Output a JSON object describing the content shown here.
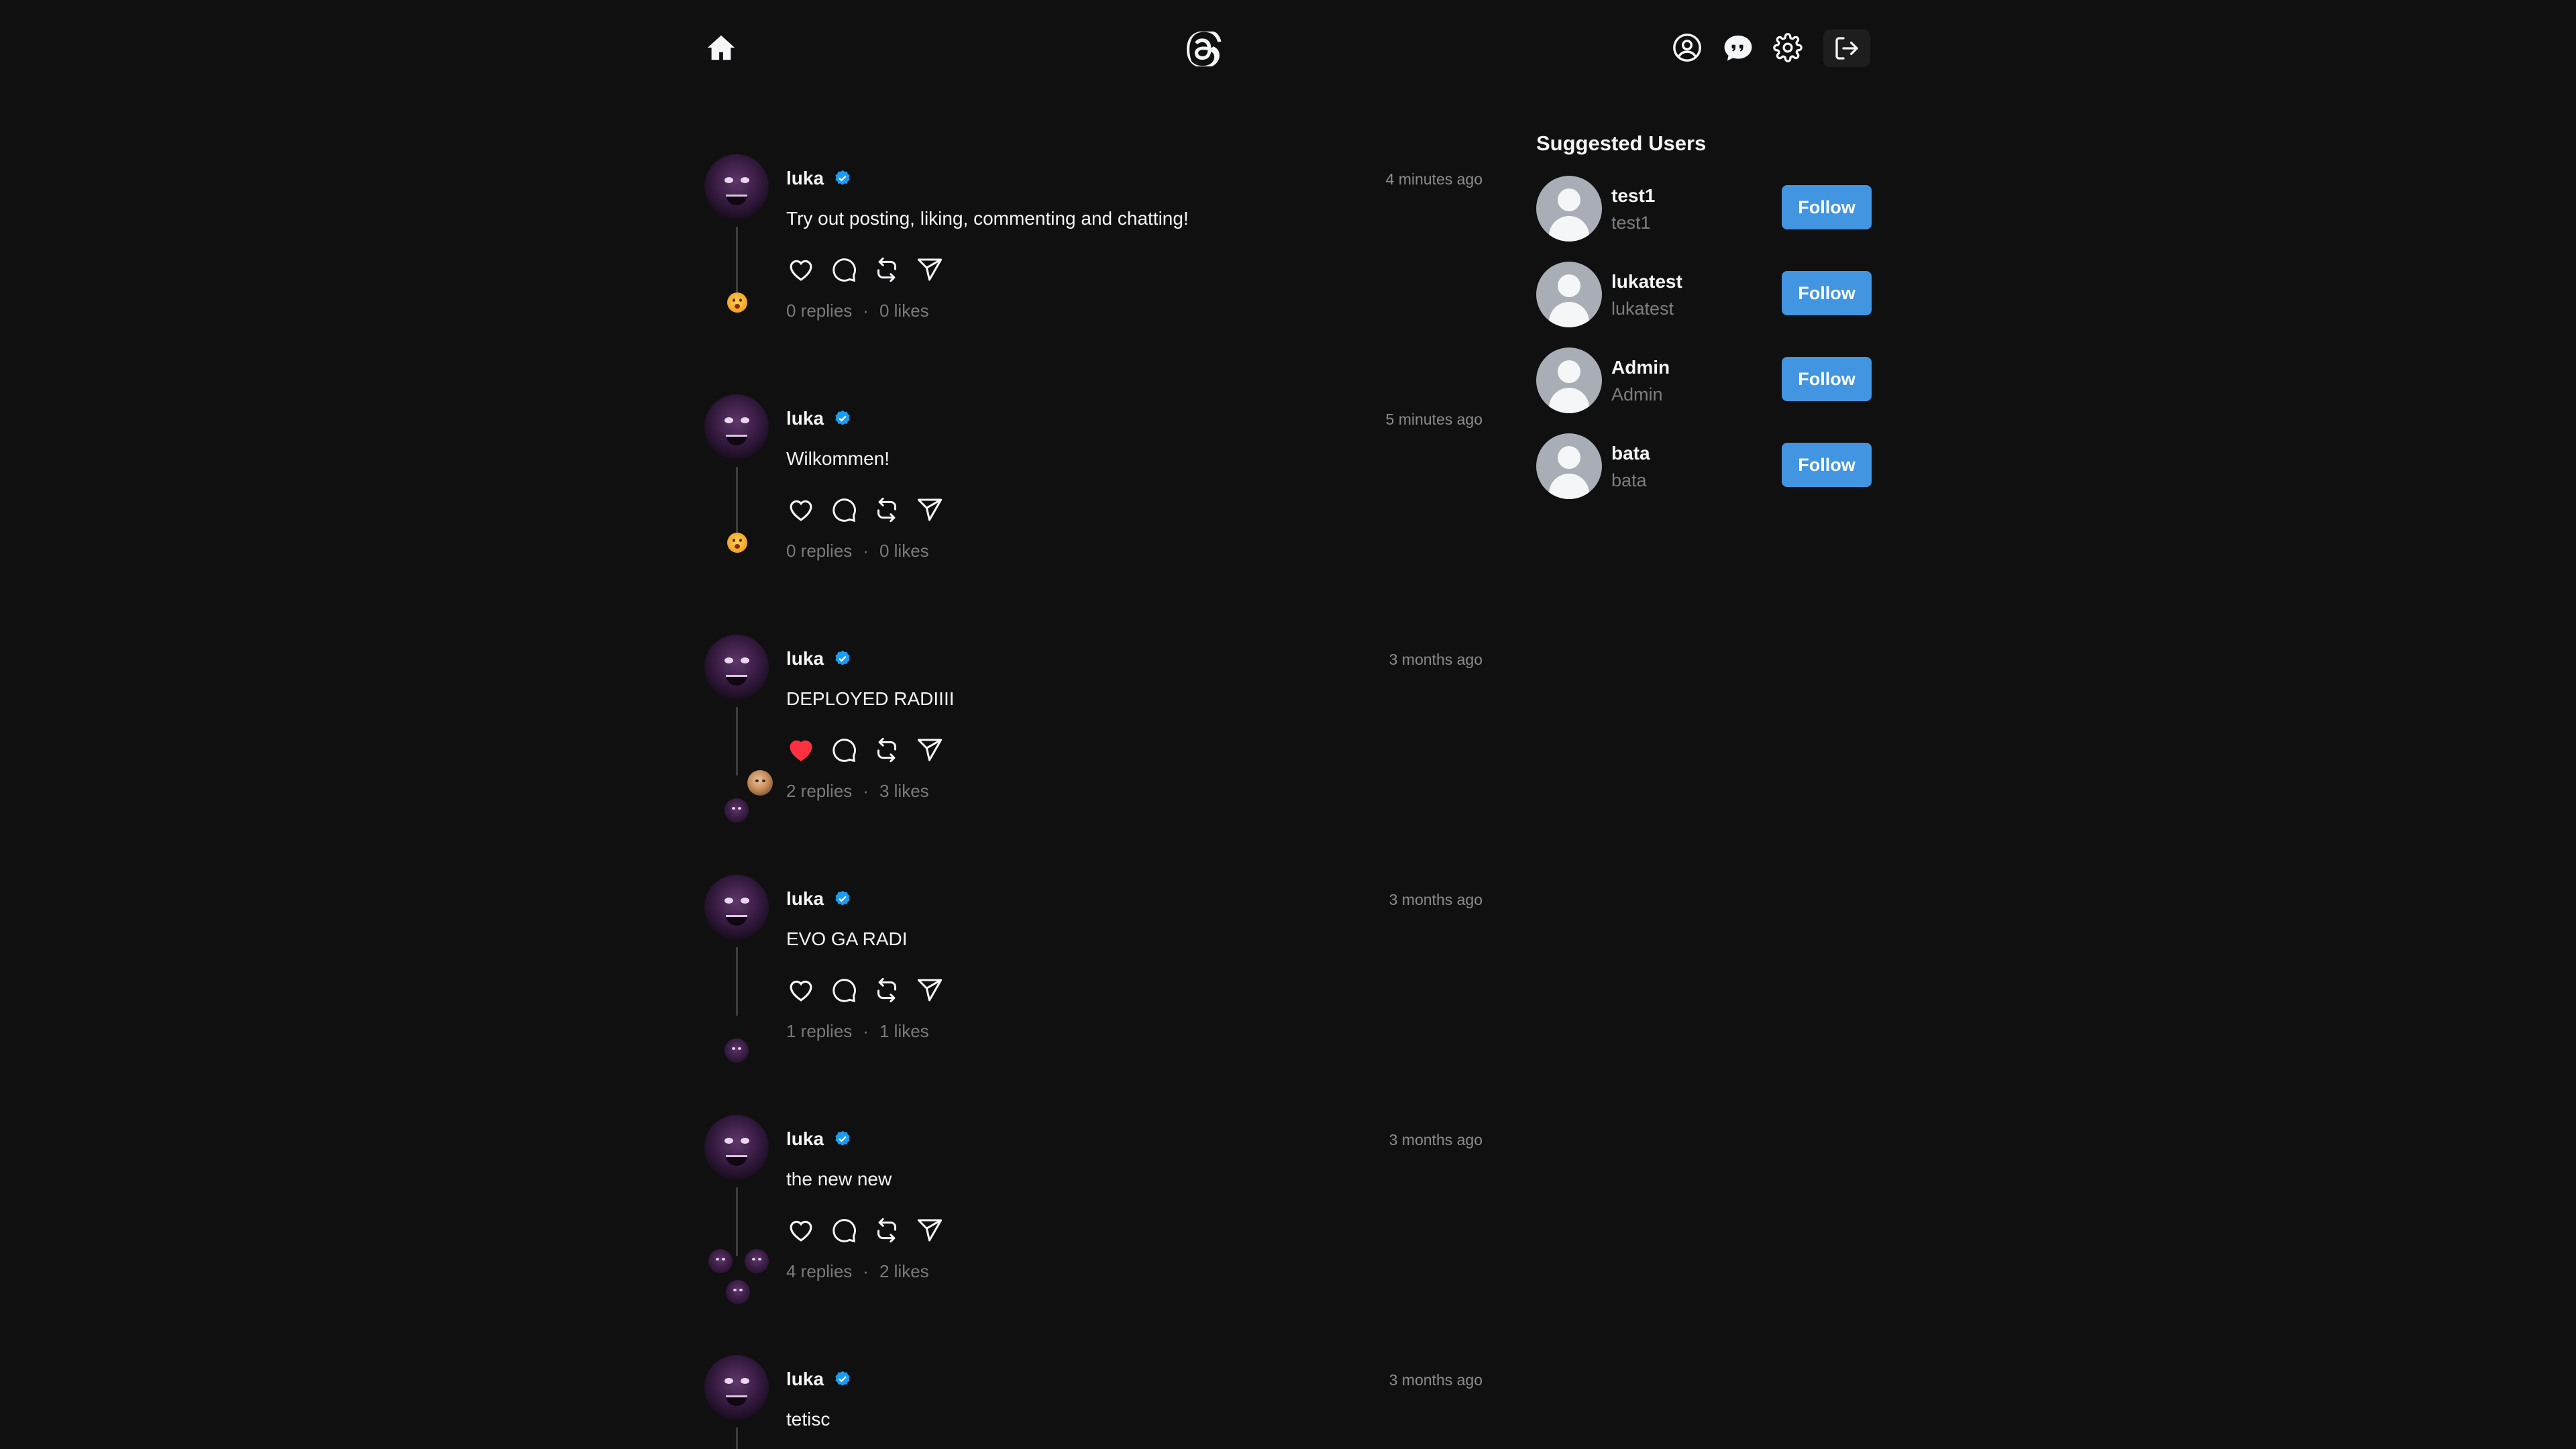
{
  "header": {
    "icons": [
      "home-icon",
      "threads-logo-icon",
      "profile-icon",
      "chat-icon",
      "gear-icon",
      "logout-icon"
    ]
  },
  "posts": [
    {
      "username": "luka",
      "time": "4 minutes ago",
      "text": "Try out posting, liking, commenting and chatting!",
      "liked": false,
      "replies": "0 replies",
      "likes": "0 likes"
    },
    {
      "username": "luka",
      "time": "5 minutes ago",
      "text": "Wilkommen!",
      "liked": false,
      "replies": "0 replies",
      "likes": "0 likes"
    },
    {
      "username": "luka",
      "time": "3 months ago",
      "text": "DEPLOYED RADIIII",
      "liked": true,
      "replies": "2 replies",
      "likes": "3 likes"
    },
    {
      "username": "luka",
      "time": "3 months ago",
      "text": "EVO GA RADI",
      "liked": false,
      "replies": "1 replies",
      "likes": "1 likes"
    },
    {
      "username": "luka",
      "time": "3 months ago",
      "text": "the new new",
      "liked": false,
      "replies": "4 replies",
      "likes": "2 likes"
    },
    {
      "username": "luka",
      "time": "3 months ago",
      "text": "tetisc",
      "liked": false,
      "replies": "",
      "likes": ""
    }
  ],
  "stats_separator": "·",
  "sidebar": {
    "title": "Suggested Users",
    "users": [
      {
        "name": "test1",
        "handle": "test1",
        "button": "Follow"
      },
      {
        "name": "lukatest",
        "handle": "lukatest",
        "button": "Follow"
      },
      {
        "name": "Admin",
        "handle": "Admin",
        "button": "Follow"
      },
      {
        "name": "bata",
        "handle": "bata",
        "button": "Follow"
      }
    ]
  },
  "colors": {
    "background": "#101010",
    "follow_button": "#4295e0",
    "liked_heart": "#ff3040",
    "verified_badge": "#1d9bf0"
  }
}
